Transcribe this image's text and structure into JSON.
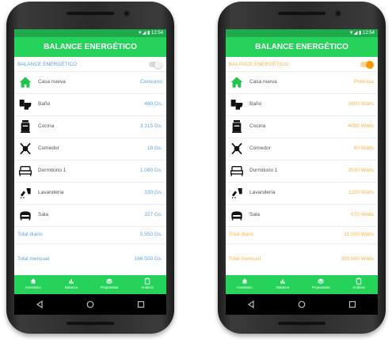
{
  "colors": {
    "green": "#25d25a",
    "dark_green": "#1faa4d",
    "blue": "#5ba4e5",
    "orange": "#ffb347"
  },
  "left": {
    "status_time": "12:54",
    "title": "BALANCE ENERGÉTICO",
    "toggle_label": "BALANCE ENERGÉTICO",
    "toggle_state": "off",
    "header_label": "Casa nueva",
    "header_value": "Consumo",
    "rows": [
      {
        "icon": "bathroom-icon",
        "label": "Baño",
        "value": "480 Gs."
      },
      {
        "icon": "stove-icon",
        "label": "Cocina",
        "value": "3.315 Gs."
      },
      {
        "icon": "dining-icon",
        "label": "Comedor",
        "value": "18 Gs."
      },
      {
        "icon": "bed-icon",
        "label": "Dormitorio 1",
        "value": "1.080 Gs."
      },
      {
        "icon": "laundry-icon",
        "label": "Lavandería",
        "value": "330 Gs."
      },
      {
        "icon": "sofa-icon",
        "label": "Sala",
        "value": "327 Gs."
      }
    ],
    "total_daily_label": "Total diario",
    "total_daily_value": "5.550 Gs.",
    "total_monthly_label": "Total mensual",
    "total_monthly_value": "166.500 Gs."
  },
  "right": {
    "status_time": "12:54",
    "title": "BALANCE ENERGÉTICO",
    "toggle_label": "BALANCE ENERGÉTICO",
    "toggle_state": "on",
    "header_label": "Casa nueva",
    "header_value": "Potencia",
    "rows": [
      {
        "icon": "bathroom-icon",
        "label": "Baño",
        "value": "1600 Watts"
      },
      {
        "icon": "stove-icon",
        "label": "Cocina",
        "value": "4090 Watts"
      },
      {
        "icon": "dining-icon",
        "label": "Comedor",
        "value": "60 Watts"
      },
      {
        "icon": "bed-icon",
        "label": "Dormitorio 1",
        "value": "3500 Watts"
      },
      {
        "icon": "laundry-icon",
        "label": "Lavandería",
        "value": "1100 Watts"
      },
      {
        "icon": "sofa-icon",
        "label": "Sala",
        "value": "670 Watts"
      }
    ],
    "total_daily_label": "Total diario",
    "total_daily_value": "11.020 Watts",
    "total_monthly_label": "Total mensual",
    "total_monthly_value": "330.600 Watts"
  },
  "nav": [
    {
      "icon": "home-icon",
      "label": "Inventario"
    },
    {
      "icon": "chart-icon",
      "label": "Balance"
    },
    {
      "icon": "layers-icon",
      "label": "Propuestas"
    },
    {
      "icon": "clipboard-icon",
      "label": "Análisis"
    }
  ]
}
